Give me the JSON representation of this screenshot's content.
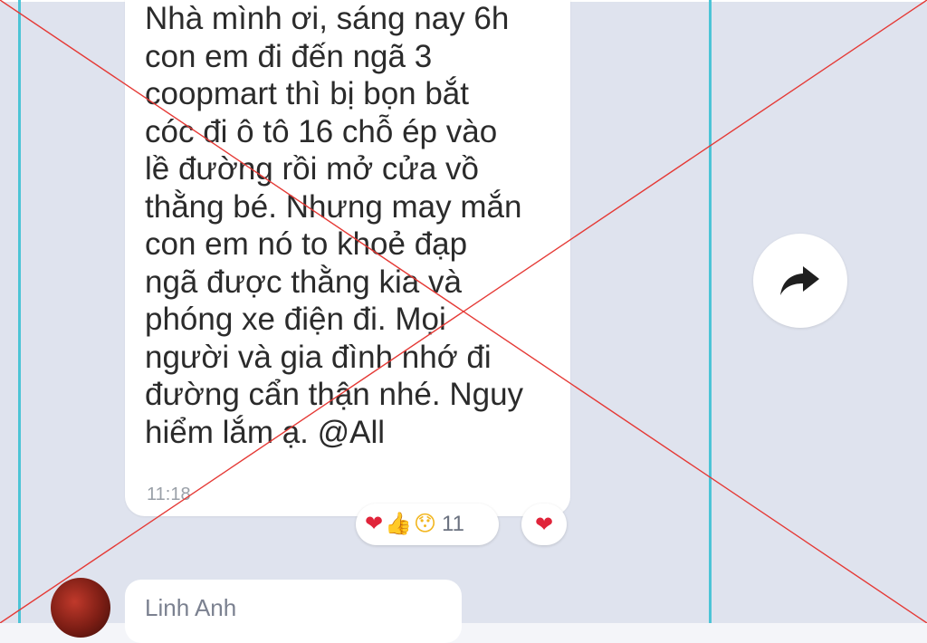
{
  "message": {
    "text": "Nhà mình ơi, sáng nay 6h\ncon em đi đến ngã 3\ncoopmart thì bị bọn bắt\ncóc đi ô tô 16 chỗ ép vào\nlề đường rồi mở cửa vồ\nthằng bé. Nhưng may mắn\ncon em nó to khoẻ đạp\nngã được thằng kia và\nphóng xe điện đi. Mọi\nngười và gia đình nhớ đi\nđường cẩn thận nhé. Nguy\nhiểm lắm ạ. @All",
    "time": "11:18"
  },
  "reactions": {
    "emojis": [
      "❤",
      "👍",
      "😯"
    ],
    "count": "11",
    "mine": "❤"
  },
  "share_icon": "share-arrow-icon",
  "next_message": {
    "sender": "Linh Anh"
  },
  "colors": {
    "chat_background": "#dfe3ee",
    "bubble": "#ffffff",
    "frame_lines": "#4cc4d6",
    "cross_lines": "#e53935",
    "heart": "#e0243a"
  }
}
